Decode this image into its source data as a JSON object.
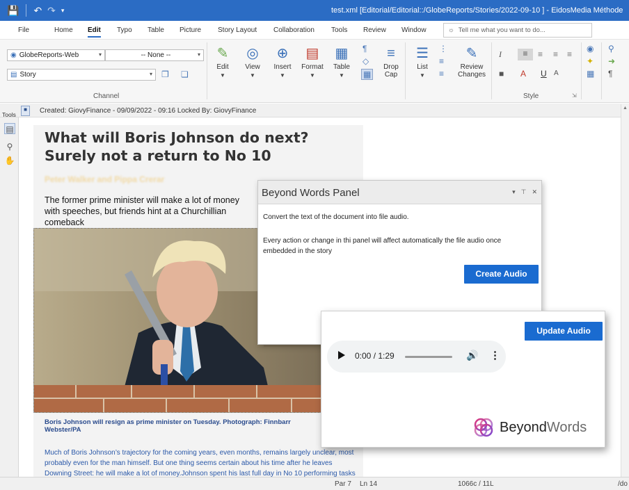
{
  "window": {
    "title": "test.xml  [Editorial/Editorial::/GlobeReports/Stories/2022-09-10 ] - EidosMedia Méthode"
  },
  "menu": {
    "tabs": [
      "File",
      "Home",
      "Edit",
      "Typo",
      "Table",
      "Picture",
      "Story Layout",
      "Collaboration",
      "Tools",
      "Review",
      "Window"
    ],
    "active_tab": "Edit",
    "tell_me_placeholder": "Tell me what you want to do..."
  },
  "ribbon": {
    "channel_combo": "GlobeReports-Web",
    "none_combo": "-- None --",
    "story_combo": "Story",
    "group_channel": "Channel",
    "group_style": "Style",
    "buttons": {
      "edit": "Edit",
      "view": "View",
      "insert": "Insert",
      "format": "Format",
      "table": "Table",
      "drop_cap_1": "Drop",
      "drop_cap_2": "Cap",
      "list": "List",
      "review_1": "Review",
      "review_2": "Changes"
    }
  },
  "infobar": {
    "tools_label": "Tools",
    "created": "Created: GiovyFinance - 09/09/2022 - 09:16   Locked By: GiovyFinance"
  },
  "article": {
    "headline": "What will Boris Johnson do next? Surely not a return to No 10",
    "byline": "Peter Walker and Pippa Crerar",
    "standfirst": "The former prime minister will make a lot of money with speeches, but friends hint at a Churchillian comeback",
    "caption": "Boris Johnson will resign as prime minister on Tuesday. Photograph: Finnbarr Webster/PA",
    "body": "Much of Boris Johnson’s trajectory for the coming years, even months, remains largely unclear, most probably even for the man himself. But one thing seems certain about his time after he leaves Downing Street: he will make a lot of money.Johnson spent his last full day in No 10 performing tasks"
  },
  "panel": {
    "title": "Beyond Words Panel",
    "desc1": "Convert the text of the document into file audio.",
    "desc2": "Every action or change in thi panel will affect automatically the file audio once embedded in the story",
    "create_button": "Create Audio",
    "update_button": "Update Audio",
    "audio_time": "0:00 / 1:29",
    "audio_progress": 0.0,
    "logo_word_a": "Beyond",
    "logo_word_b": "Words"
  },
  "statusbar": {
    "par": "Par 7",
    "ln": "Ln 14",
    "chars": "1066c / 11L",
    "extra": "/do"
  },
  "colors": {
    "titlebar": "#2b6cc4",
    "button_blue": "#1a6bd0",
    "caption_blue": "#2a4b8d"
  }
}
